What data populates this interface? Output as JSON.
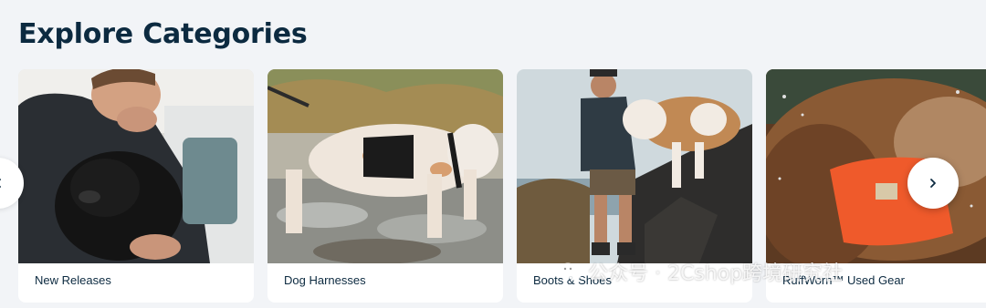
{
  "section": {
    "title": "Explore Categories"
  },
  "categories": [
    {
      "label": "New Releases",
      "image": "person-hugging-black-dog"
    },
    {
      "label": "Dog Harnesses",
      "image": "dog-in-black-harness-at-river"
    },
    {
      "label": "Boots & Shoes",
      "image": "hiker-with-dog-on-rocks"
    },
    {
      "label": "RuffWorn™ Used Gear",
      "image": "dog-in-orange-vest-shaking"
    }
  ],
  "navigation": {
    "prev_icon": "chevron-left-icon",
    "next_icon": "chevron-right-icon"
  },
  "watermark": {
    "icon": "wechat-icon",
    "text": "公众号 · 2Cshop跨境研究社"
  },
  "colors": {
    "page_background": "#f2f4f7",
    "title_text": "#0c2a40",
    "card_background": "#ffffff",
    "harness_orange": "#ef5a2b"
  }
}
